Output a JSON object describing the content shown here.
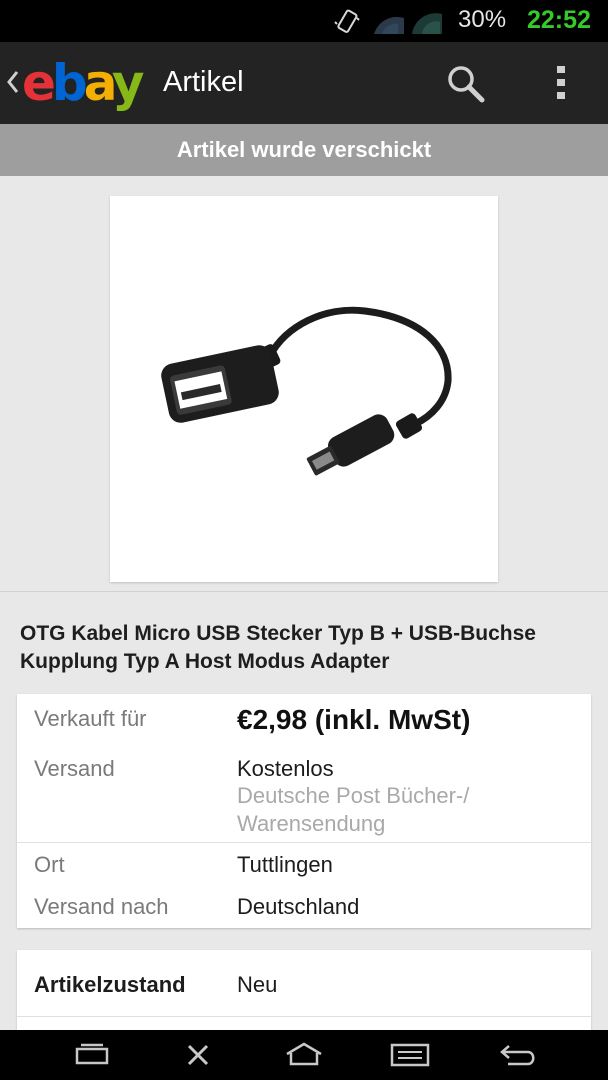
{
  "status_bar": {
    "battery": "30%",
    "time": "22:52",
    "icons": [
      "vibrate-icon",
      "wifi-icon",
      "signal-icon"
    ]
  },
  "action_bar": {
    "logo_letters": [
      "e",
      "b",
      "a",
      "y"
    ],
    "title": "Artikel",
    "icons": [
      "back-chevron-icon",
      "search-icon",
      "overflow-menu-icon"
    ]
  },
  "banner": {
    "text": "Artikel wurde verschickt"
  },
  "item": {
    "title": "OTG Kabel Micro USB Stecker Typ B + USB-Buchse Kupplung Typ A Host Modus Adapter",
    "image_icon": "otg-cable-image"
  },
  "details": {
    "sold_for_label": "Verkauft für",
    "sold_for_value": "€2,98 (inkl. MwSt)",
    "shipping_label": "Versand",
    "shipping_value": "Kostenlos",
    "shipping_service_line1": "Deutsche Post Bücher-/",
    "shipping_service_line2": "Warensendung",
    "location_label": "Ort",
    "location_value": "Tuttlingen",
    "ships_to_label": "Versand nach",
    "ships_to_value": "Deutschland"
  },
  "condition": {
    "label": "Artikelzustand",
    "value": "Neu"
  },
  "nav_bar": {
    "icons": [
      "recent-apps-icon",
      "close-icon",
      "home-icon",
      "menu-icon",
      "back-icon"
    ]
  },
  "colors": {
    "ebay_e": "#e53238",
    "ebay_b": "#0064d2",
    "ebay_a": "#f5af02",
    "ebay_y": "#86b817",
    "clock": "#37c92b",
    "banner_bg": "#9e9e9e",
    "actionbar_bg": "#232323"
  }
}
